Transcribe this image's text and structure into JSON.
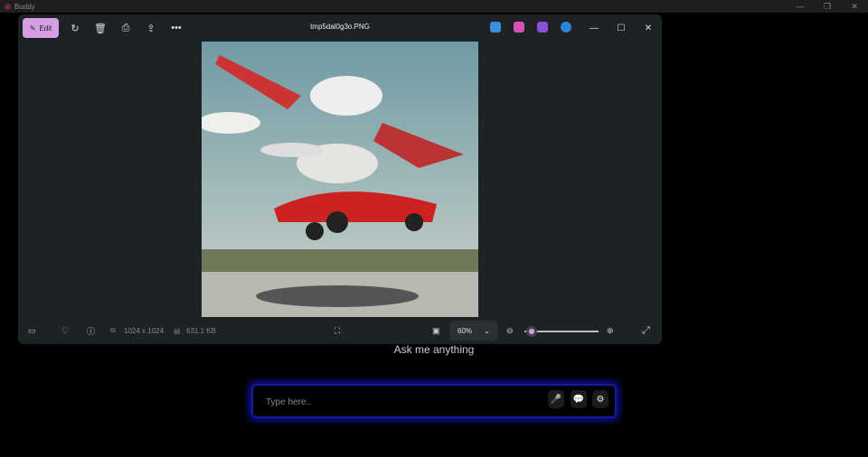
{
  "app": {
    "title": "Buddy",
    "minimize": "—",
    "restore": "❐",
    "close": "✕"
  },
  "photos": {
    "edit_label": "Edit",
    "filename": "tmp5dal0g3o.PNG",
    "minimize": "—",
    "maximize": "☐",
    "close": "✕",
    "dimensions": "1024 x 1024",
    "file_size": "631.1 KB",
    "zoom_level": "60%",
    "zoom_fraction": 0.1,
    "app_colors": [
      "#3b8fe0",
      "#d653b5",
      "#8b4fd8",
      "#2a85d8"
    ]
  },
  "chat": {
    "prompt": "Ask me anything",
    "placeholder": "Type here.."
  }
}
